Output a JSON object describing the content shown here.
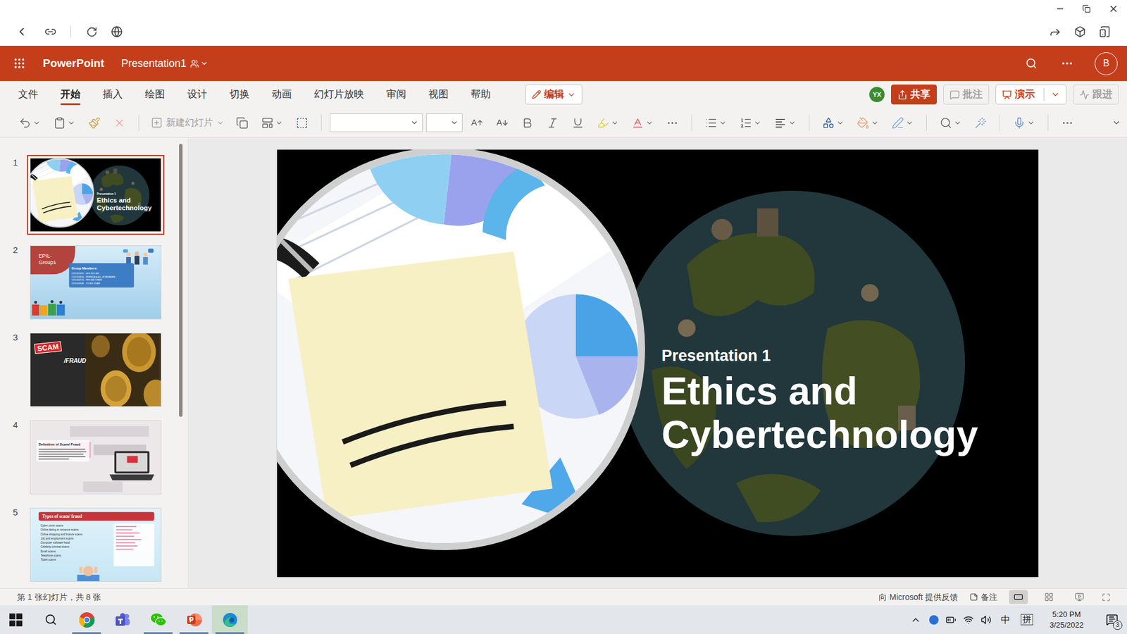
{
  "app": {
    "name": "PowerPoint",
    "document": "Presentation1",
    "user_initial": "B"
  },
  "ribbon": {
    "tabs": [
      {
        "label": "文件",
        "selected": false
      },
      {
        "label": "开始",
        "selected": true
      },
      {
        "label": "插入",
        "selected": false
      },
      {
        "label": "绘图",
        "selected": false
      },
      {
        "label": "设计",
        "selected": false
      },
      {
        "label": "切换",
        "selected": false
      },
      {
        "label": "动画",
        "selected": false
      },
      {
        "label": "幻灯片放映",
        "selected": false
      },
      {
        "label": "审阅",
        "selected": false
      },
      {
        "label": "视图",
        "selected": false
      },
      {
        "label": "帮助",
        "selected": false
      }
    ],
    "mode": "编辑",
    "coauthor": "YX",
    "actions": [
      {
        "label": "共享",
        "kind": "share",
        "disabled": false
      },
      {
        "label": "批注",
        "kind": "comments",
        "disabled": true
      },
      {
        "label": "演示",
        "kind": "present",
        "disabled": false
      },
      {
        "label": "跟进",
        "kind": "catchup",
        "disabled": true
      }
    ]
  },
  "toolbar": {
    "new_slide": {
      "label": "新建幻灯片",
      "disabled": true
    }
  },
  "slides": [
    {
      "number": "1",
      "selected": true,
      "kind": "title",
      "subtitle": "Presentation 1",
      "title": "Ethics and Cybertechnology"
    },
    {
      "number": "2",
      "selected": false,
      "kind": "members",
      "title": "EPIL-Group1",
      "heading": "Group Members:",
      "members": [
        "1211205491 - LEE ZUO AN",
        "1211203660 - SREEKALA A/L JEYARAMAN",
        "1211200594 - TEH KAI CHAIN",
        "1211203036 - YU BUI XUAN"
      ]
    },
    {
      "number": "3",
      "selected": false,
      "kind": "scam",
      "stamp": "SCAM",
      "title": "/FRAUD"
    },
    {
      "number": "4",
      "selected": false,
      "kind": "definition",
      "title": "Definition of Scam/ Fraud"
    },
    {
      "number": "5",
      "selected": false,
      "kind": "list",
      "title": "Types of scam/ fraud",
      "items": [
        "Cyber crime scams",
        "Online dating or romance scams",
        "Online shopping and finance scams",
        "Job and employment scams",
        "Computer software fraud",
        "Celebrity criminal scams",
        "Email scams",
        "Telephone scams",
        "Ticket scams"
      ]
    }
  ],
  "status_bar": {
    "position": "第 1 张幻灯片，共 8 张",
    "feedback": "向 Microsoft 提供反馈",
    "notes": "备注",
    "views": [
      {
        "kind": "normal",
        "selected": true
      },
      {
        "kind": "sorter",
        "selected": false
      },
      {
        "kind": "reading",
        "selected": false
      }
    ]
  },
  "taskbar": {
    "apps": [
      {
        "kind": "chrome",
        "running": true,
        "selected": false
      },
      {
        "kind": "teams",
        "running": false,
        "selected": false
      },
      {
        "kind": "wechat",
        "running": true,
        "selected": false
      },
      {
        "kind": "powerpoint",
        "running": true,
        "selected": false
      },
      {
        "kind": "edge",
        "running": true,
        "selected": true
      }
    ],
    "ime_lang": "中",
    "ime_mode": "拼",
    "time": "5:20 PM",
    "date": "3/25/2022",
    "notifications": "3"
  }
}
